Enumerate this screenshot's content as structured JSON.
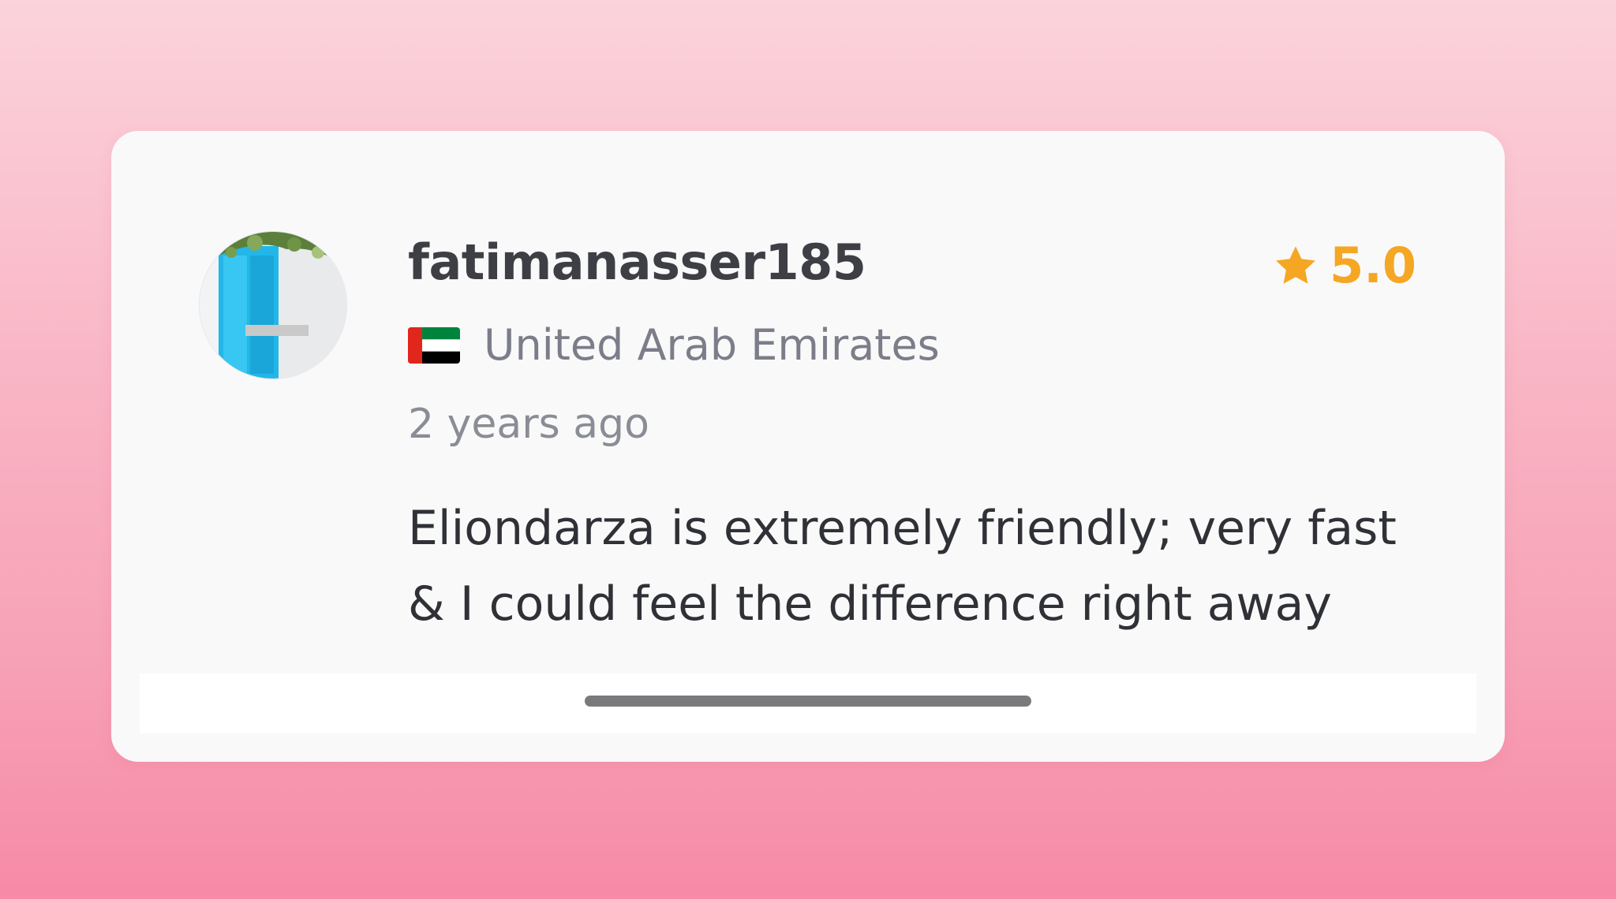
{
  "review": {
    "username": "fatimanasser185",
    "rating": "5.0",
    "rating_icon": "star-icon",
    "country": "United Arab Emirates",
    "country_flag": "uae-flag-icon",
    "time_ago": "2 years ago",
    "text": "Eliondarza is extremely friendly; very fast & I could feel the difference right away"
  },
  "colors": {
    "rating": "#f5a623",
    "username": "#3d3f44",
    "muted": "#7b7e88",
    "body_text": "#2f3136",
    "card_bg": "#f9f9fa",
    "background_top": "#fbd3db",
    "background_bottom": "#f78aa6"
  }
}
